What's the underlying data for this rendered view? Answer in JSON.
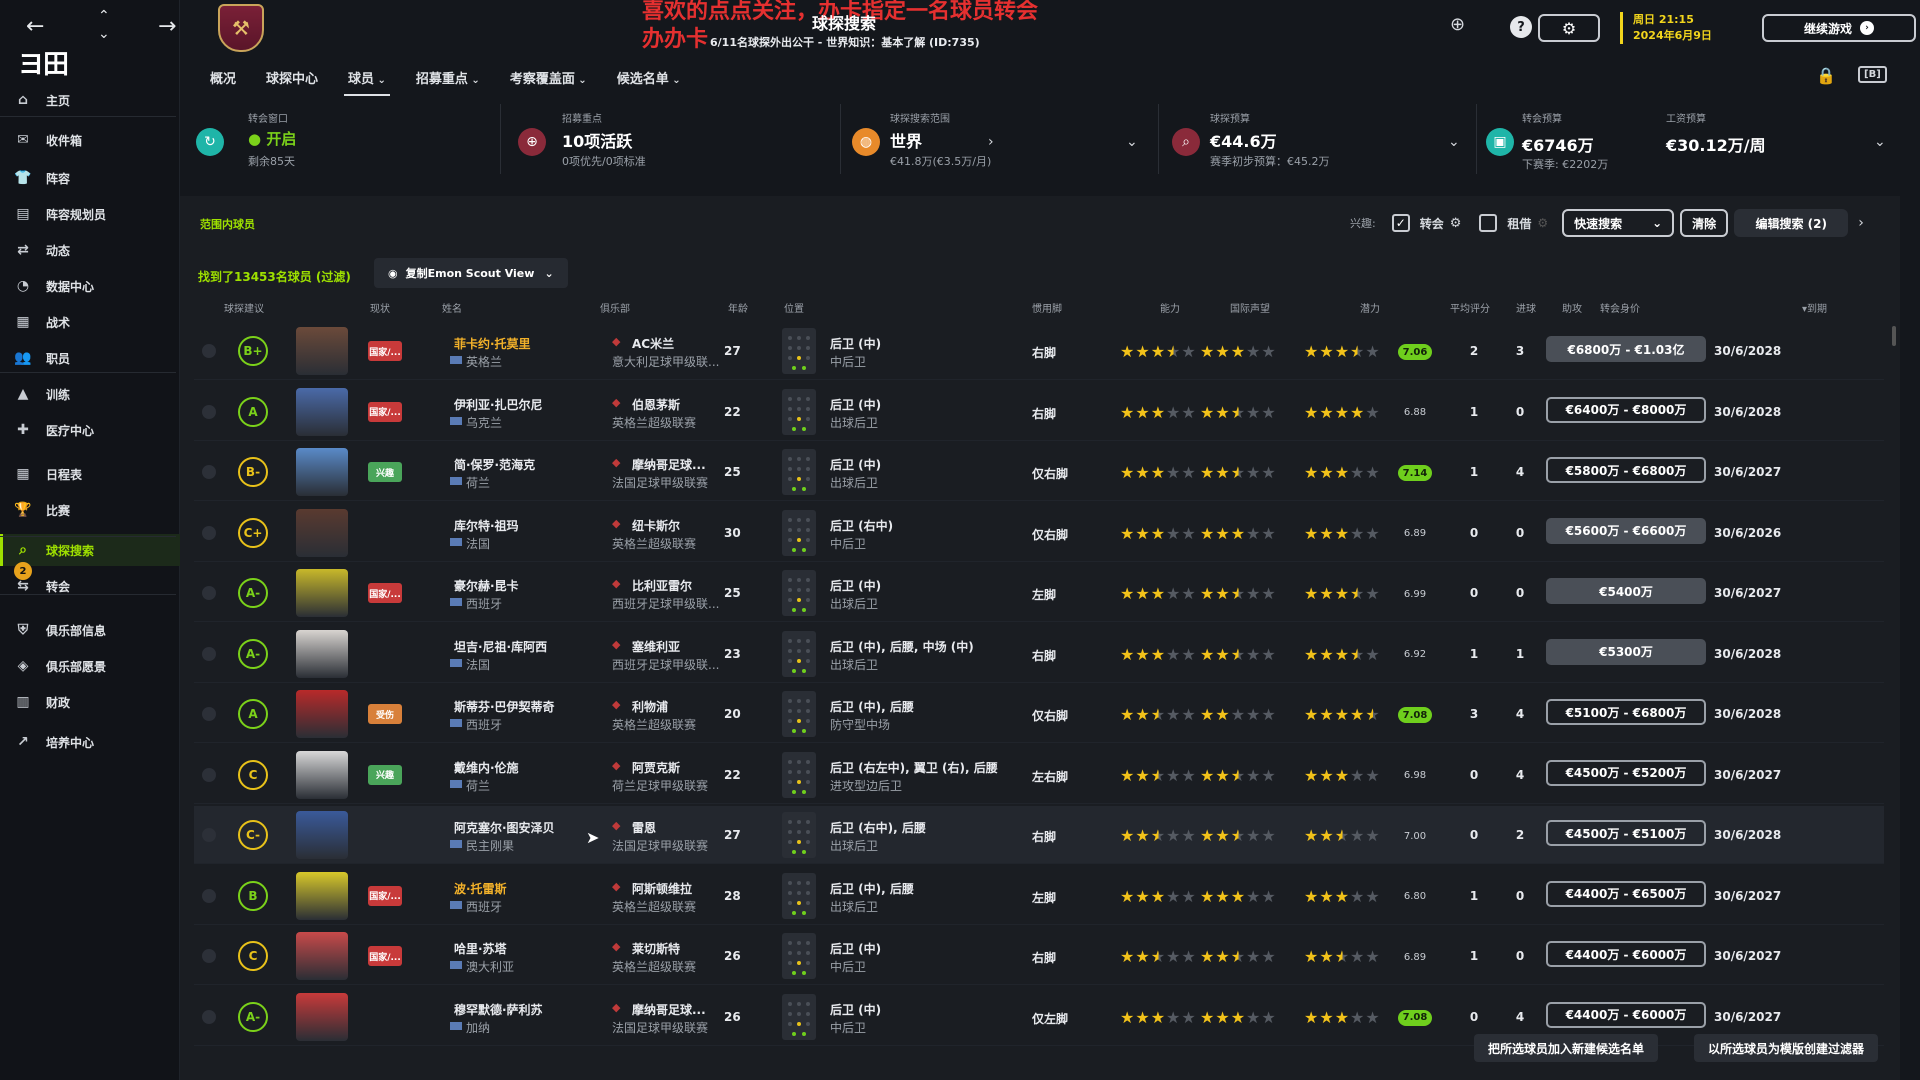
{
  "app": {
    "logo": "ヨ田",
    "page_title": "球探搜索",
    "page_subtitle": "6/11名球探外出公干 - 世界知识：基本了解 (ID:735)",
    "promo_line1": "喜欢的点点关注，办卡指定一名球员转会",
    "promo_line2": "办办卡"
  },
  "topbar": {
    "date_line1": "周日 21:15",
    "date_line2": "2024年6月9日",
    "continue_label": "继续游戏"
  },
  "sidebar": {
    "items": [
      {
        "label": "主页",
        "icon": "home-icon"
      },
      {
        "label": "收件箱",
        "icon": "inbox-icon"
      },
      {
        "label": "阵容",
        "icon": "squad-icon"
      },
      {
        "label": "阵容规划员",
        "icon": "planner-icon"
      },
      {
        "label": "动态",
        "icon": "dynamics-icon"
      },
      {
        "label": "数据中心",
        "icon": "data-icon"
      },
      {
        "label": "战术",
        "icon": "tactics-icon"
      },
      {
        "label": "职员",
        "icon": "staff-icon"
      },
      {
        "label": "训练",
        "icon": "training-icon"
      },
      {
        "label": "医疗中心",
        "icon": "medical-icon"
      },
      {
        "label": "日程表",
        "icon": "calendar-icon"
      },
      {
        "label": "比赛",
        "icon": "trophy-icon"
      },
      {
        "label": "球探搜索",
        "icon": "search-icon"
      },
      {
        "label": "转会",
        "icon": "transfer-icon",
        "badge": "2"
      },
      {
        "label": "俱乐部信息",
        "icon": "shield-icon"
      },
      {
        "label": "俱乐部愿景",
        "icon": "vision-icon"
      },
      {
        "label": "财政",
        "icon": "finance-icon"
      },
      {
        "label": "培养中心",
        "icon": "development-icon"
      }
    ]
  },
  "tabs": [
    "概况",
    "球探中心",
    "球员",
    "招募重点",
    "考察覆盖面",
    "候选名单"
  ],
  "summary": {
    "window": {
      "title": "转会窗口",
      "value": "开启",
      "sub": "剩余85天"
    },
    "focus": {
      "title": "招募重点",
      "value": "10项活跃",
      "sub": "0项优先/0项标准"
    },
    "range": {
      "title": "球探搜索范围",
      "value": "世界",
      "sub": "€41.8万(€3.5万/月)"
    },
    "scout_budget": {
      "title": "球探预算",
      "value": "€44.6万",
      "sub": "赛季初步预算：€45.2万"
    },
    "transfer_budget": {
      "title": "转会预算",
      "value": "€6746万",
      "sub": "下赛季: €2202万"
    },
    "wage_budget": {
      "title": "工资预算",
      "value": "€30.12万/周"
    }
  },
  "filters": {
    "range_label": "范围内球员",
    "interest": "兴趣:",
    "transfer": "转会",
    "loan": "租借",
    "quick_search": "快速搜索",
    "clear": "清除",
    "edit_search": "编辑搜索 (2)",
    "found": "找到了13453名球员 (过滤)",
    "view": "复制Emon Scout View"
  },
  "columns": [
    "球探建议",
    "现状",
    "姓名",
    "俱乐部",
    "年龄",
    "位置",
    "惯用脚",
    "能力",
    "国际声望",
    "潜力",
    "平均评分",
    "进球",
    "助攻",
    "转会身价",
    "▾到期"
  ],
  "players": [
    {
      "grade": "B+",
      "gc": "g",
      "status": "国家/...",
      "sc": "#c83a3a",
      "name": "菲卡约·托莫里",
      "gold": true,
      "nat": "英格兰",
      "club": "AC米兰",
      "league": "意大利足球甲级联...",
      "age": "27",
      "pos": "后卫 (中)",
      "role": "中后卫",
      "foot": "右脚",
      "ability": 3.5,
      "rep": 3,
      "pot": 3.5,
      "rating": "7.06",
      "rg": true,
      "goals": "2",
      "assists": "3",
      "value": "€6800万 - €1.03亿",
      "vf": true,
      "exp": "30/6/2028",
      "face": "#6b4a3a"
    },
    {
      "grade": "A",
      "gc": "g",
      "status": "国家/...",
      "sc": "#c83a3a",
      "name": "伊利亚·扎巴尔尼",
      "gold": false,
      "nat": "乌克兰",
      "club": "伯恩茅斯",
      "league": "英格兰超级联赛",
      "age": "22",
      "pos": "后卫 (中)",
      "role": "出球后卫",
      "foot": "右脚",
      "ability": 3,
      "rep": 2.5,
      "pot": 4,
      "rating": "6.88",
      "rg": false,
      "goals": "1",
      "assists": "0",
      "value": "€6400万 - €8000万",
      "vf": false,
      "exp": "30/6/2028",
      "face": "#4a6aa8"
    },
    {
      "grade": "B-",
      "gc": "y",
      "status": "兴趣",
      "sc": "#4aa55a",
      "name": "简·保罗·范海克",
      "gold": false,
      "nat": "荷兰",
      "club": "摩纳哥足球...",
      "league": "法国足球甲级联赛",
      "age": "25",
      "pos": "后卫 (中)",
      "role": "出球后卫",
      "foot": "仅右脚",
      "ability": 3,
      "rep": 2.5,
      "pot": 3,
      "rating": "7.14",
      "rg": true,
      "goals": "1",
      "assists": "4",
      "value": "€5800万 - €6800万",
      "vf": false,
      "exp": "30/6/2027",
      "face": "#5a8ac8"
    },
    {
      "grade": "C+",
      "gc": "y",
      "status": "",
      "sc": "",
      "name": "库尔特·祖玛",
      "gold": false,
      "nat": "法国",
      "club": "纽卡斯尔",
      "league": "英格兰超级联赛",
      "age": "30",
      "pos": "后卫 (右中)",
      "role": "中后卫",
      "foot": "仅右脚",
      "ability": 3,
      "rep": 3,
      "pot": 3,
      "rating": "6.89",
      "rg": false,
      "goals": "0",
      "assists": "0",
      "value": "€5600万 - €6600万",
      "vf": true,
      "exp": "30/6/2026",
      "face": "#5a3a30"
    },
    {
      "grade": "A-",
      "gc": "g",
      "status": "国家/...",
      "sc": "#c83a3a",
      "name": "豪尔赫·昆卡",
      "gold": false,
      "nat": "西班牙",
      "club": "比利亚雷尔",
      "league": "西班牙足球甲级联...",
      "age": "25",
      "pos": "后卫 (中)",
      "role": "出球后卫",
      "foot": "左脚",
      "ability": 3,
      "rep": 2.5,
      "pot": 3.5,
      "rating": "6.99",
      "rg": false,
      "goals": "0",
      "assists": "0",
      "value": "€5400万",
      "vf": true,
      "exp": "30/6/2027",
      "face": "#c8b82a"
    },
    {
      "grade": "A-",
      "gc": "g",
      "status": "",
      "sc": "",
      "name": "坦吉·尼祖·库阿西",
      "gold": false,
      "nat": "法国",
      "club": "塞维利亚",
      "league": "西班牙足球甲级联...",
      "age": "23",
      "pos": "后卫 (中), 后腰, 中场 (中)",
      "role": "出球后卫",
      "foot": "右脚",
      "ability": 3,
      "rep": 2.5,
      "pot": 3.5,
      "rating": "6.92",
      "rg": false,
      "goals": "1",
      "assists": "1",
      "value": "€5300万",
      "vf": true,
      "exp": "30/6/2028",
      "face": "#d8d4d0"
    },
    {
      "grade": "A",
      "gc": "g",
      "status": "受伤",
      "sc": "#d8803a",
      "name": "斯蒂芬·巴伊契蒂奇",
      "gold": false,
      "nat": "西班牙",
      "club": "利物浦",
      "league": "英格兰超级联赛",
      "age": "20",
      "pos": "后卫 (中), 后腰",
      "role": "防守型中场",
      "foot": "仅右脚",
      "ability": 2.5,
      "rep": 2,
      "pot": 4.5,
      "rating": "7.08",
      "rg": true,
      "goals": "3",
      "assists": "4",
      "value": "€5100万 - €6800万",
      "vf": false,
      "exp": "30/6/2028",
      "face": "#b82a2a"
    },
    {
      "grade": "C",
      "gc": "y",
      "status": "兴趣",
      "sc": "#4aa55a",
      "name": "戴维内·伦施",
      "gold": false,
      "nat": "荷兰",
      "club": "阿贾克斯",
      "league": "荷兰足球甲级联赛",
      "age": "22",
      "pos": "后卫 (右左中), 翼卫 (右), 后腰",
      "role": "进攻型边后卫",
      "foot": "左右脚",
      "ability": 2.5,
      "rep": 2.5,
      "pot": 3,
      "rating": "6.98",
      "rg": false,
      "goals": "0",
      "assists": "4",
      "value": "€4500万 - €5200万",
      "vf": false,
      "exp": "30/6/2027",
      "face": "#d8d8d8"
    },
    {
      "grade": "C-",
      "gc": "y",
      "status": "",
      "sc": "",
      "name": "阿克塞尔·图安泽贝",
      "gold": false,
      "nat": "民主刚果",
      "club": "雷恩",
      "league": "法国足球甲级联赛",
      "age": "27",
      "pos": "后卫 (右中), 后腰",
      "role": "出球后卫",
      "foot": "右脚",
      "ability": 2.5,
      "rep": 2.5,
      "pot": 2.5,
      "rating": "7.00",
      "rg": false,
      "goals": "0",
      "assists": "2",
      "value": "€4500万 - €5100万",
      "vf": false,
      "exp": "30/6/2028",
      "face": "#3a5a9a",
      "hl": true
    },
    {
      "grade": "B",
      "gc": "g",
      "status": "国家/...",
      "sc": "#c83a3a",
      "name": "波·托雷斯",
      "gold": true,
      "nat": "西班牙",
      "club": "阿斯顿维拉",
      "league": "英格兰超级联赛",
      "age": "28",
      "pos": "后卫 (中), 后腰",
      "role": "出球后卫",
      "foot": "左脚",
      "ability": 3,
      "rep": 3,
      "pot": 3,
      "rating": "6.80",
      "rg": false,
      "goals": "1",
      "assists": "0",
      "value": "€4400万 - €6500万",
      "vf": false,
      "exp": "30/6/2027",
      "face": "#d8c82a"
    },
    {
      "grade": "C",
      "gc": "y",
      "status": "国家/...",
      "sc": "#c83a3a",
      "name": "哈里·苏塔",
      "gold": false,
      "nat": "澳大利亚",
      "club": "莱切斯特",
      "league": "英格兰超级联赛",
      "age": "26",
      "pos": "后卫 (中)",
      "role": "中后卫",
      "foot": "右脚",
      "ability": 2.5,
      "rep": 2.5,
      "pot": 2.5,
      "rating": "6.89",
      "rg": false,
      "goals": "1",
      "assists": "0",
      "value": "€4400万 - €6000万",
      "vf": false,
      "exp": "30/6/2027",
      "face": "#c84a4a"
    },
    {
      "grade": "A-",
      "gc": "g",
      "status": "",
      "sc": "",
      "name": "穆罕默德·萨利苏",
      "gold": false,
      "nat": "加纳",
      "club": "摩纳哥足球...",
      "league": "法国足球甲级联赛",
      "age": "26",
      "pos": "后卫 (中)",
      "role": "中后卫",
      "foot": "仅左脚",
      "ability": 3,
      "rep": 3,
      "pot": 3,
      "rating": "7.08",
      "rg": true,
      "goals": "0",
      "assists": "4",
      "value": "€4400万 - €6000万",
      "vf": false,
      "exp": "30/6/2027",
      "face": "#c83a3a"
    }
  ],
  "bottom": {
    "add_shortlist": "把所选球员加入新建候选名单",
    "create_filter": "以所选球员为模版创建过滤器"
  }
}
